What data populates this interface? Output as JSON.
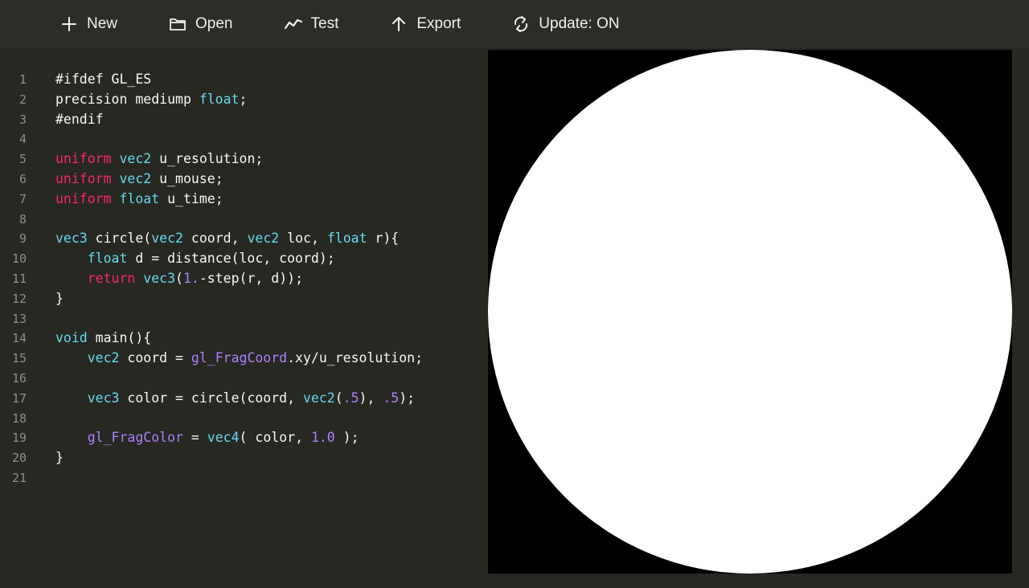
{
  "toolbar": {
    "buttons": [
      {
        "label": "New",
        "icon": "plus-icon"
      },
      {
        "label": "Open",
        "icon": "folder-icon"
      },
      {
        "label": "Test",
        "icon": "chart-line-icon"
      },
      {
        "label": "Export",
        "icon": "arrow-up-icon"
      },
      {
        "label": "Update: ON",
        "icon": "refresh-icon"
      }
    ]
  },
  "editor": {
    "lines": [
      {
        "n": "1",
        "tokens": [
          {
            "t": "#ifdef GL_ES",
            "c": "plain"
          }
        ]
      },
      {
        "n": "2",
        "tokens": [
          {
            "t": "precision mediump ",
            "c": "plain"
          },
          {
            "t": "float",
            "c": "type"
          },
          {
            "t": ";",
            "c": "plain"
          }
        ]
      },
      {
        "n": "3",
        "tokens": [
          {
            "t": "#endif",
            "c": "plain"
          }
        ]
      },
      {
        "n": "4",
        "tokens": []
      },
      {
        "n": "5",
        "tokens": [
          {
            "t": "uniform",
            "c": "kw"
          },
          {
            "t": " ",
            "c": "plain"
          },
          {
            "t": "vec2",
            "c": "type"
          },
          {
            "t": " u_resolution;",
            "c": "plain"
          }
        ]
      },
      {
        "n": "6",
        "tokens": [
          {
            "t": "uniform",
            "c": "kw"
          },
          {
            "t": " ",
            "c": "plain"
          },
          {
            "t": "vec2",
            "c": "type"
          },
          {
            "t": " u_mouse;",
            "c": "plain"
          }
        ]
      },
      {
        "n": "7",
        "tokens": [
          {
            "t": "uniform",
            "c": "kw"
          },
          {
            "t": " ",
            "c": "plain"
          },
          {
            "t": "float",
            "c": "type"
          },
          {
            "t": " u_time;",
            "c": "plain"
          }
        ]
      },
      {
        "n": "8",
        "tokens": []
      },
      {
        "n": "9",
        "tokens": [
          {
            "t": "vec3",
            "c": "type"
          },
          {
            "t": " circle(",
            "c": "plain"
          },
          {
            "t": "vec2",
            "c": "type"
          },
          {
            "t": " coord, ",
            "c": "plain"
          },
          {
            "t": "vec2",
            "c": "type"
          },
          {
            "t": " loc, ",
            "c": "plain"
          },
          {
            "t": "float",
            "c": "type"
          },
          {
            "t": " r){",
            "c": "plain"
          }
        ]
      },
      {
        "n": "10",
        "tokens": [
          {
            "t": "    ",
            "c": "plain"
          },
          {
            "t": "float",
            "c": "type"
          },
          {
            "t": " d = distance(loc, coord);",
            "c": "plain"
          }
        ]
      },
      {
        "n": "11",
        "tokens": [
          {
            "t": "    ",
            "c": "plain"
          },
          {
            "t": "return",
            "c": "kw"
          },
          {
            "t": " ",
            "c": "plain"
          },
          {
            "t": "vec3",
            "c": "type"
          },
          {
            "t": "(",
            "c": "plain"
          },
          {
            "t": "1.",
            "c": "num"
          },
          {
            "t": "-step(r, d));",
            "c": "plain"
          }
        ]
      },
      {
        "n": "12",
        "tokens": [
          {
            "t": "}",
            "c": "plain"
          }
        ]
      },
      {
        "n": "13",
        "tokens": []
      },
      {
        "n": "14",
        "tokens": [
          {
            "t": "void",
            "c": "type"
          },
          {
            "t": " main(){",
            "c": "plain"
          }
        ]
      },
      {
        "n": "15",
        "tokens": [
          {
            "t": "    ",
            "c": "plain"
          },
          {
            "t": "vec2",
            "c": "type"
          },
          {
            "t": " coord = ",
            "c": "plain"
          },
          {
            "t": "gl_FragCoord",
            "c": "builtin"
          },
          {
            "t": ".xy/u_resolution;",
            "c": "plain"
          }
        ]
      },
      {
        "n": "16",
        "tokens": []
      },
      {
        "n": "17",
        "tokens": [
          {
            "t": "    ",
            "c": "plain"
          },
          {
            "t": "vec3",
            "c": "type"
          },
          {
            "t": " color = circle(coord, ",
            "c": "plain"
          },
          {
            "t": "vec2",
            "c": "type"
          },
          {
            "t": "(",
            "c": "plain"
          },
          {
            "t": ".5",
            "c": "num"
          },
          {
            "t": "), ",
            "c": "plain"
          },
          {
            "t": ".5",
            "c": "num"
          },
          {
            "t": ");",
            "c": "plain"
          }
        ]
      },
      {
        "n": "18",
        "tokens": []
      },
      {
        "n": "19",
        "tokens": [
          {
            "t": "    ",
            "c": "plain"
          },
          {
            "t": "gl_FragColor",
            "c": "builtin"
          },
          {
            "t": " = ",
            "c": "plain"
          },
          {
            "t": "vec4",
            "c": "type"
          },
          {
            "t": "( color, ",
            "c": "plain"
          },
          {
            "t": "1.0",
            "c": "num"
          },
          {
            "t": " );",
            "c": "plain"
          }
        ]
      },
      {
        "n": "20",
        "tokens": [
          {
            "t": "}",
            "c": "plain"
          }
        ]
      },
      {
        "n": "21",
        "tokens": []
      }
    ]
  },
  "preview": {
    "background": "#000000",
    "circle_color": "#ffffff"
  },
  "colors": {
    "background": "#272822",
    "toolbar": "#2c2c28",
    "keyword": "#f92672",
    "type": "#66d9ef",
    "number": "#ae81ff",
    "text": "#f8f8f2",
    "gutter": "#8f908a"
  }
}
